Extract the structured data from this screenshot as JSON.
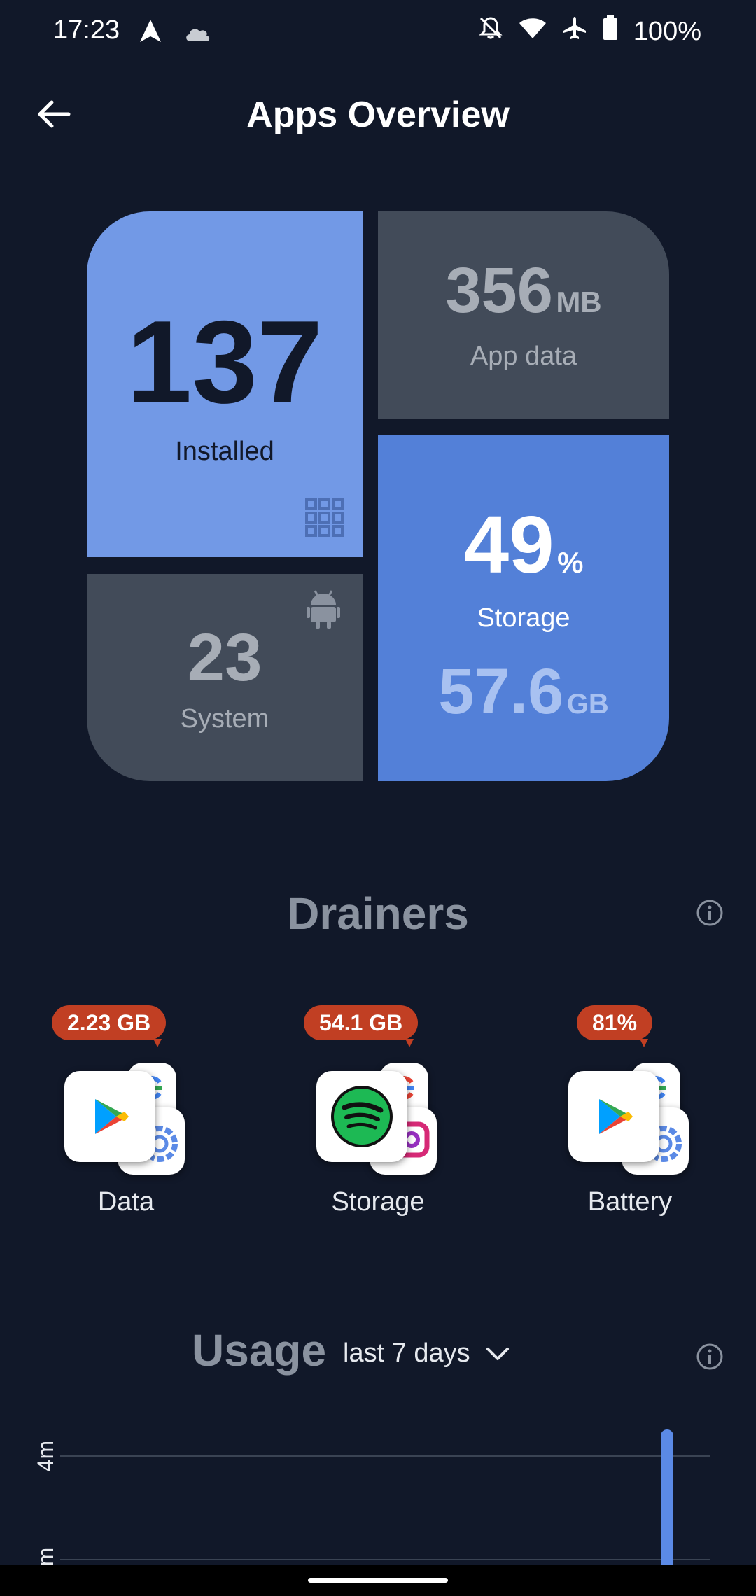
{
  "status_bar": {
    "time": "17:23",
    "battery": "100%",
    "icons": [
      "navigation-icon",
      "cloud-icon",
      "bell-off-icon",
      "wifi-icon",
      "airplane-icon",
      "battery-icon"
    ]
  },
  "header": {
    "title": "Apps Overview",
    "back_icon": "arrow-left-icon"
  },
  "overview": {
    "installed": {
      "value": "137",
      "label": "Installed",
      "icon": "grid-icon"
    },
    "app_data": {
      "value": "356",
      "unit": "MB",
      "label": "App data"
    },
    "system": {
      "value": "23",
      "label": "System",
      "icon": "android-icon"
    },
    "storage": {
      "percent": "49",
      "percent_unit": "%",
      "label": "Storage",
      "size": "57.6",
      "size_unit": "GB"
    }
  },
  "drainers": {
    "title": "Drainers",
    "info_icon": "info-icon",
    "items": [
      {
        "label": "Data",
        "badge": "2.23 GB",
        "front_icon": "google-play-icon",
        "back_icons": [
          "google-icon",
          "settings-gear-icon"
        ]
      },
      {
        "label": "Storage",
        "badge": "54.1 GB",
        "front_icon": "spotify-icon",
        "back_icons": [
          "google-icon",
          "instagram-icon"
        ]
      },
      {
        "label": "Battery",
        "badge": "81%",
        "front_icon": "google-play-icon",
        "back_icons": [
          "google-icon",
          "settings-gear-icon"
        ]
      }
    ]
  },
  "usage": {
    "title": "Usage",
    "range": "last 7 days",
    "dropdown_icon": "chevron-down-icon",
    "info_icon": "info-icon"
  },
  "chart_data": {
    "type": "bar",
    "title": "",
    "y_ticks": [
      "4m",
      "m"
    ],
    "colors": {
      "bar": "#5b8ae6",
      "grid": "#3a4353"
    }
  },
  "colors": {
    "background": "#111829",
    "installed_tile": "#7299e6",
    "storage_tile": "#5380d8",
    "neutral_tile": "#424b59",
    "badge": "#c13f23"
  }
}
